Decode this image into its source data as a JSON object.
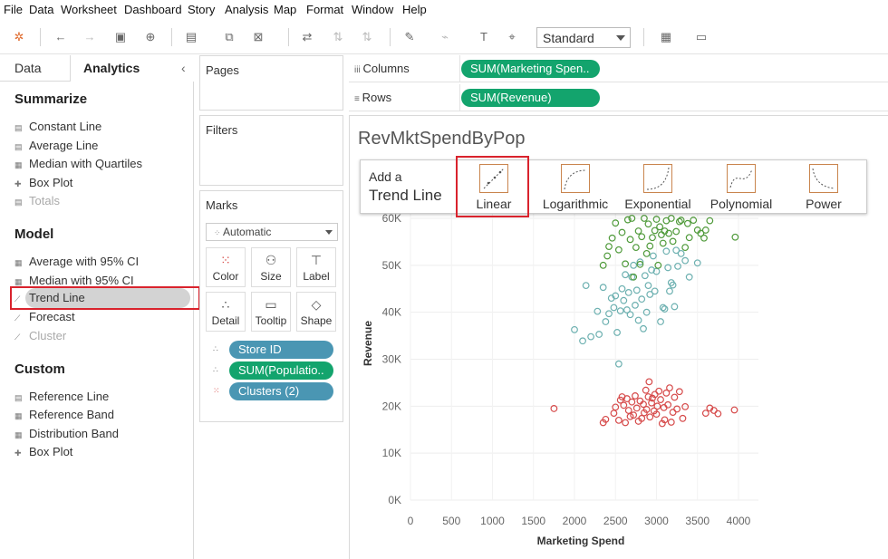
{
  "menu": [
    "File",
    "Data",
    "Worksheet",
    "Dashboard",
    "Story",
    "Analysis",
    "Map",
    "Format",
    "Window",
    "Help"
  ],
  "toolbar": {
    "fit_value": "Standard"
  },
  "left_panel": {
    "tabs": [
      "Data",
      "Analytics"
    ],
    "collapse_glyph": "‹",
    "summarize": {
      "title": "Summarize",
      "items": [
        "Constant Line",
        "Average Line",
        "Median with Quartiles",
        "Box Plot",
        "Totals"
      ]
    },
    "model": {
      "title": "Model",
      "items": [
        "Average with 95% CI",
        "Median with 95% CI",
        "Trend Line",
        "Forecast",
        "Cluster"
      ]
    },
    "custom": {
      "title": "Custom",
      "items": [
        "Reference Line",
        "Reference Band",
        "Distribution Band",
        "Box Plot"
      ]
    }
  },
  "pages": {
    "title": "Pages"
  },
  "filters": {
    "title": "Filters"
  },
  "marks": {
    "title": "Marks",
    "type": "Automatic",
    "buttons": [
      "Color",
      "Size",
      "Label",
      "Detail",
      "Tooltip",
      "Shape"
    ],
    "fields": [
      "Store ID",
      "SUM(Populatio..",
      "Clusters (2)"
    ]
  },
  "shelves": {
    "columns_label": "Columns",
    "columns_pill": "SUM(Marketing Spen..",
    "rows_label": "Rows",
    "rows_pill": "SUM(Revenue)"
  },
  "sheet": {
    "title": "RevMktSpendByPop"
  },
  "trend_popup": {
    "add_line1": "Add a",
    "add_line2": "Trend Line",
    "models": [
      "Linear",
      "Logarithmic",
      "Exponential",
      "Polynomial",
      "Power"
    ]
  },
  "chart_data": {
    "type": "scatter",
    "xlabel": "Marketing Spend",
    "ylabel": "Revenue",
    "x_ticks": [
      "0",
      "500",
      "1000",
      "1500",
      "2000",
      "2500",
      "3000",
      "3500",
      "4000"
    ],
    "y_ticks": [
      "0K",
      "10K",
      "20K",
      "30K",
      "40K",
      "50K",
      "60K"
    ],
    "xlim": [
      0,
      4000
    ],
    "ylim": [
      0,
      60000
    ],
    "grid": true,
    "series": [
      {
        "color": "#d64a4a",
        "points": [
          [
            1750,
            19500
          ],
          [
            2350,
            16500
          ],
          [
            2380,
            17200
          ],
          [
            2480,
            18500
          ],
          [
            2500,
            19800
          ],
          [
            2540,
            17000
          ],
          [
            2560,
            21300
          ],
          [
            2580,
            22000
          ],
          [
            2600,
            20200
          ],
          [
            2620,
            16500
          ],
          [
            2640,
            21600
          ],
          [
            2660,
            19100
          ],
          [
            2680,
            17800
          ],
          [
            2700,
            20900
          ],
          [
            2720,
            18100
          ],
          [
            2740,
            22200
          ],
          [
            2760,
            19600
          ],
          [
            2780,
            16800
          ],
          [
            2800,
            21100
          ],
          [
            2820,
            17400
          ],
          [
            2840,
            20400
          ],
          [
            2850,
            18600
          ],
          [
            2870,
            23400
          ],
          [
            2880,
            19300
          ],
          [
            2900,
            22000
          ],
          [
            2910,
            25200
          ],
          [
            2920,
            17700
          ],
          [
            2940,
            20700
          ],
          [
            2950,
            21700
          ],
          [
            2970,
            19000
          ],
          [
            2980,
            22500
          ],
          [
            3000,
            18300
          ],
          [
            3010,
            20000
          ],
          [
            3030,
            23200
          ],
          [
            3050,
            21400
          ],
          [
            3070,
            16300
          ],
          [
            3090,
            19700
          ],
          [
            3100,
            17100
          ],
          [
            3120,
            22800
          ],
          [
            3140,
            20300
          ],
          [
            3160,
            23900
          ],
          [
            3180,
            16600
          ],
          [
            3200,
            18700
          ],
          [
            3220,
            21900
          ],
          [
            3250,
            19400
          ],
          [
            3280,
            23100
          ],
          [
            3320,
            17400
          ],
          [
            3350,
            19900
          ],
          [
            3600,
            18500
          ],
          [
            3650,
            19600
          ],
          [
            3700,
            19100
          ],
          [
            3750,
            18400
          ],
          [
            3950,
            19200
          ]
        ]
      },
      {
        "color": "#6cb0b0",
        "points": [
          [
            2000,
            36300
          ],
          [
            2100,
            33900
          ],
          [
            2140,
            45700
          ],
          [
            2200,
            34800
          ],
          [
            2280,
            40200
          ],
          [
            2300,
            35300
          ],
          [
            2350,
            45300
          ],
          [
            2380,
            38000
          ],
          [
            2420,
            39700
          ],
          [
            2450,
            43000
          ],
          [
            2480,
            41000
          ],
          [
            2500,
            43500
          ],
          [
            2520,
            35700
          ],
          [
            2540,
            29000
          ],
          [
            2560,
            40300
          ],
          [
            2580,
            45000
          ],
          [
            2600,
            42500
          ],
          [
            2620,
            48000
          ],
          [
            2640,
            40500
          ],
          [
            2660,
            44200
          ],
          [
            2680,
            39500
          ],
          [
            2700,
            47500
          ],
          [
            2720,
            50000
          ],
          [
            2740,
            41500
          ],
          [
            2760,
            44700
          ],
          [
            2780,
            38300
          ],
          [
            2800,
            50700
          ],
          [
            2820,
            42800
          ],
          [
            2840,
            36500
          ],
          [
            2860,
            47800
          ],
          [
            2880,
            40000
          ],
          [
            2900,
            45700
          ],
          [
            2920,
            43800
          ],
          [
            2940,
            49000
          ],
          [
            2960,
            52000
          ],
          [
            2980,
            44500
          ],
          [
            3000,
            48700
          ],
          [
            3050,
            38000
          ],
          [
            3080,
            41000
          ],
          [
            3100,
            40700
          ],
          [
            3120,
            53000
          ],
          [
            3140,
            49500
          ],
          [
            3160,
            44500
          ],
          [
            3180,
            46300
          ],
          [
            3200,
            45800
          ],
          [
            3220,
            41200
          ],
          [
            3240,
            53200
          ],
          [
            3260,
            49800
          ],
          [
            3300,
            52500
          ],
          [
            3350,
            51000
          ],
          [
            3400,
            47500
          ],
          [
            3500,
            50500
          ]
        ]
      },
      {
        "color": "#4f9a3a",
        "points": [
          [
            2350,
            50000
          ],
          [
            2400,
            52000
          ],
          [
            2420,
            54000
          ],
          [
            2460,
            55800
          ],
          [
            2500,
            59000
          ],
          [
            2540,
            53300
          ],
          [
            2580,
            57000
          ],
          [
            2620,
            50300
          ],
          [
            2650,
            59700
          ],
          [
            2680,
            55500
          ],
          [
            2700,
            60000
          ],
          [
            2720,
            47500
          ],
          [
            2750,
            53800
          ],
          [
            2780,
            57300
          ],
          [
            2800,
            50200
          ],
          [
            2820,
            56100
          ],
          [
            2850,
            60000
          ],
          [
            2880,
            52500
          ],
          [
            2900,
            58800
          ],
          [
            2920,
            54100
          ],
          [
            2950,
            55900
          ],
          [
            2980,
            57400
          ],
          [
            3000,
            59800
          ],
          [
            3020,
            50000
          ],
          [
            3040,
            58200
          ],
          [
            3060,
            56500
          ],
          [
            3080,
            54700
          ],
          [
            3100,
            57300
          ],
          [
            3120,
            59500
          ],
          [
            3150,
            56800
          ],
          [
            3180,
            60000
          ],
          [
            3200,
            55100
          ],
          [
            3240,
            57200
          ],
          [
            3280,
            59300
          ],
          [
            3300,
            59600
          ],
          [
            3350,
            53800
          ],
          [
            3380,
            58900
          ],
          [
            3400,
            55900
          ],
          [
            3450,
            59600
          ],
          [
            3500,
            57500
          ],
          [
            3540,
            56800
          ],
          [
            3580,
            55800
          ],
          [
            3600,
            57500
          ],
          [
            3650,
            59500
          ],
          [
            3960,
            56000
          ]
        ]
      }
    ]
  }
}
